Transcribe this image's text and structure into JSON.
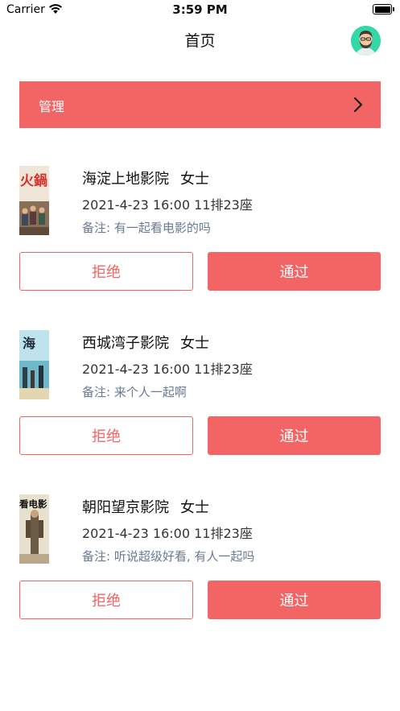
{
  "status": {
    "carrier": "Carrier",
    "time": "3:59 PM"
  },
  "nav": {
    "title": "首页"
  },
  "manage": {
    "label": "管理"
  },
  "requests": [
    {
      "cinema": "海淀上地影院",
      "gender": "女士",
      "seat": "2021-4-23 16:00 11排23座",
      "remark": "备注: 有一起看电影的吗",
      "poster_text": "火鍋",
      "reject": "拒绝",
      "approve": "通过"
    },
    {
      "cinema": "西城湾子影院",
      "gender": "女士",
      "seat": "2021-4-23 16:00 11排23座",
      "remark": "备注: 来个人一起啊",
      "poster_text": "海",
      "reject": "拒绝",
      "approve": "通过"
    },
    {
      "cinema": "朝阳望京影院",
      "gender": "女士",
      "seat": "2021-4-23 16:00 11排23座",
      "remark": "备注: 听说超级好看, 有人一起吗",
      "poster_text": "看电影",
      "reject": "拒绝",
      "approve": "通过"
    }
  ],
  "colors": {
    "accent": "#f36464",
    "remark": "#6a7a94",
    "avatar_bg": "#34d7a6"
  },
  "icons": {
    "avatar": "bearded-man-avatar-icon",
    "arrow": "chevron-right-icon",
    "wifi": "wifi-icon",
    "battery": "battery-icon"
  }
}
